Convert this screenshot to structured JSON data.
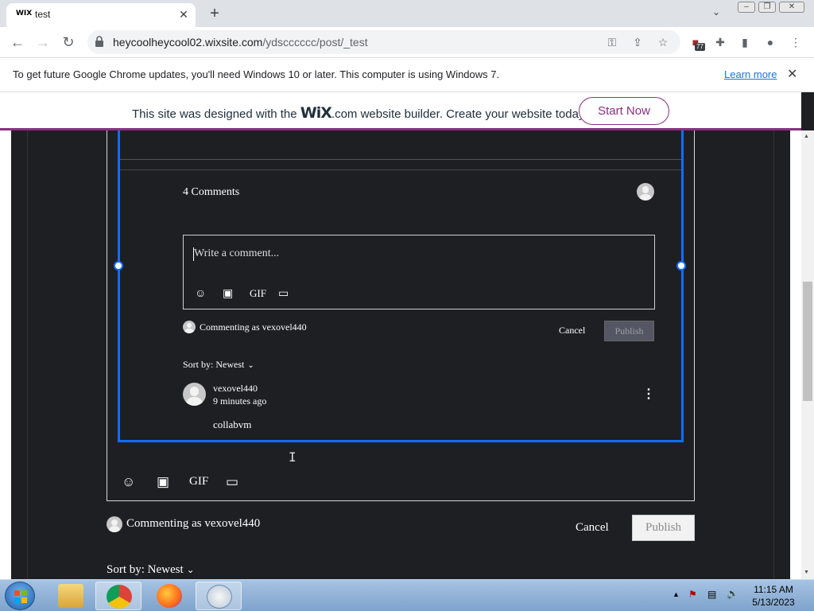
{
  "browser": {
    "tab": {
      "favicon_text": "WIX",
      "title": "test"
    },
    "url_host": "heycoolheycool02.wixsite.com",
    "url_path": "/ydscccccc/post/_test",
    "extension_badge": "77"
  },
  "infobar": {
    "message": "To get future Google Chrome updates, you'll need Windows 10 or later. This computer is using Windows 7.",
    "link": "Learn more"
  },
  "wix_banner": {
    "text_before": "This site was designed with the ",
    "logo": "WiX",
    "logo_suffix": ".com",
    "text_after": " website builder. Create your website today.",
    "button": "Start Now"
  },
  "comments": {
    "count_label": "4 Comments",
    "placeholder": "Write a comment...",
    "toolbar_gif": "GIF",
    "commenting_as": "Commenting as vexovel440",
    "cancel": "Cancel",
    "publish": "Publish",
    "sort_by": "Sort by: Newest",
    "items": [
      {
        "author": "vexovel440",
        "time": "9 minutes ago",
        "text": "collabvm"
      }
    ]
  },
  "lower_editor": {
    "gif": "GIF",
    "commenting_as": "Commenting as vexovel440",
    "cancel": "Cancel",
    "publish": "Publish",
    "sort_by": "Sort by: Newest"
  },
  "taskbar": {
    "time": "11:15 AM",
    "date": "5/13/2023"
  },
  "colors": {
    "page_bg": "#1e1f23",
    "selection_blue": "#116dff",
    "wix_accent": "#8a2f7f"
  }
}
